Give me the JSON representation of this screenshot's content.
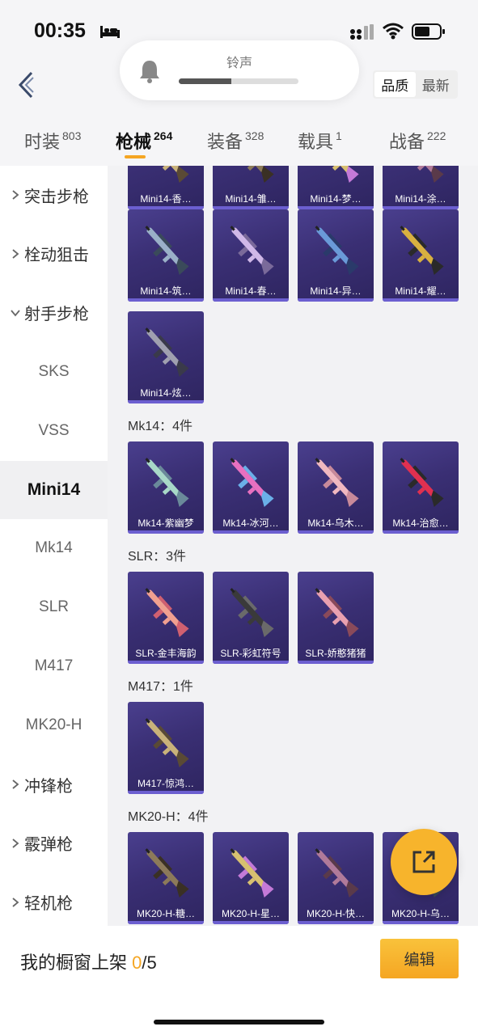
{
  "status_bar": {
    "time": "00:35"
  },
  "ringtone": {
    "label": "铃声",
    "level_percent": 44
  },
  "sort": {
    "options": [
      "品质",
      "最新"
    ],
    "active": 0
  },
  "tabs": [
    {
      "label": "时装",
      "count": "803"
    },
    {
      "label": "枪械",
      "count": "264"
    },
    {
      "label": "装备",
      "count": "328"
    },
    {
      "label": "载具",
      "count": "1"
    },
    {
      "label": "战备",
      "count": "222"
    }
  ],
  "sidebar": {
    "items": [
      {
        "label": "突击步枪",
        "kind": "category",
        "expanded": false
      },
      {
        "label": "栓动狙击",
        "kind": "category",
        "expanded": false
      },
      {
        "label": "射手步枪",
        "kind": "category",
        "expanded": true
      },
      {
        "label": "SKS",
        "kind": "sub"
      },
      {
        "label": "VSS",
        "kind": "sub"
      },
      {
        "label": "Mini14",
        "kind": "sub",
        "active": true
      },
      {
        "label": "Mk14",
        "kind": "sub"
      },
      {
        "label": "SLR",
        "kind": "sub"
      },
      {
        "label": "M417",
        "kind": "sub"
      },
      {
        "label": "MK20-H",
        "kind": "sub"
      },
      {
        "label": "冲锋枪",
        "kind": "category",
        "expanded": false
      },
      {
        "label": "霰弹枪",
        "kind": "category",
        "expanded": false
      },
      {
        "label": "轻机枪",
        "kind": "category",
        "expanded": false
      }
    ]
  },
  "sections": {
    "mini14_top": [
      "Mini14-香…",
      "Mini14-雏…",
      "Mini14-梦…",
      "Mini14-涂…"
    ],
    "mini14_row2": [
      "Mini14-筑…",
      "Mini14-春…",
      "Mini14-异…",
      "Mini14-耀…"
    ],
    "mini14_row3": [
      "Mini14-炫…"
    ],
    "mk14": {
      "title": "Mk14：4件",
      "items": [
        "Mk14-紫幽梦",
        "Mk14-冰河…",
        "Mk14-乌木…",
        "Mk14-治愈…"
      ]
    },
    "slr": {
      "title": "SLR：3件",
      "items": [
        "SLR-金丰海韵",
        "SLR-彩虹符号",
        "SLR-娇憨猪猪"
      ]
    },
    "m417": {
      "title": "M417：1件",
      "items": [
        "M417-惊鸿…"
      ]
    },
    "mk20": {
      "title": "MK20-H：4件",
      "items": [
        "MK20-H-糖…",
        "MK20-H-星…",
        "MK20-H-快…",
        "MK20-H-乌…"
      ]
    }
  },
  "bottom_bar": {
    "showcase_label": "我的橱窗上架",
    "showcase_count": "0",
    "showcase_total": "/5",
    "edit_label": "编辑"
  },
  "colors": {
    "accent": "#f5a623",
    "card": "#3a2f74"
  }
}
